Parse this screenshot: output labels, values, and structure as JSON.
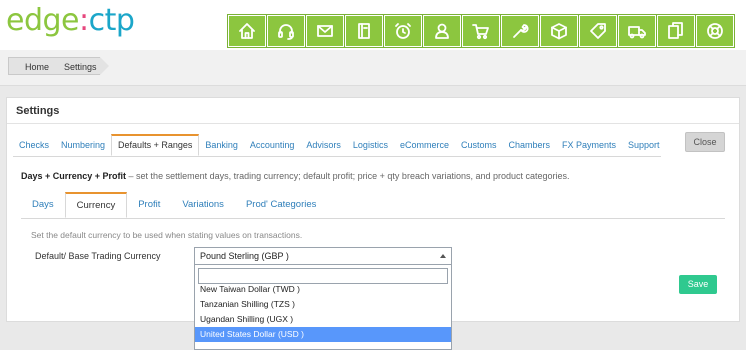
{
  "logo": {
    "part1": "edge",
    "part2": ":",
    "part3": "ctp"
  },
  "toolbar": {
    "icons": [
      "home-icon",
      "headset-icon",
      "mail-icon",
      "notebook-icon",
      "alarm-clock-icon",
      "user-icon",
      "cart-icon",
      "wrench-icon",
      "box-icon",
      "tag-icon",
      "truck-icon",
      "documents-icon",
      "lifebuoy-icon"
    ],
    "accent": "#8cc63f"
  },
  "breadcrumb": {
    "home": "Home",
    "current": "Settings"
  },
  "panel": {
    "title": "Settings",
    "tabs": [
      {
        "label": "Checks"
      },
      {
        "label": "Numbering"
      },
      {
        "label": "Defaults + Ranges"
      },
      {
        "label": "Banking"
      },
      {
        "label": "Accounting"
      },
      {
        "label": "Advisors"
      },
      {
        "label": "Logistics"
      },
      {
        "label": "eCommerce"
      },
      {
        "label": "Customs"
      },
      {
        "label": "Chambers"
      },
      {
        "label": "FX Payments"
      },
      {
        "label": "Support"
      }
    ],
    "active_tab": "Defaults + Ranges",
    "close_label": "Close"
  },
  "section": {
    "title": "Days + Currency + Profit",
    "description": " – set the settlement days, trading currency; default profit; price + qty breach variations, and product categories."
  },
  "subtabs": {
    "items": [
      {
        "label": "Days"
      },
      {
        "label": "Currency"
      },
      {
        "label": "Profit"
      },
      {
        "label": "Variations"
      },
      {
        "label": "Prod' Categories"
      }
    ],
    "active": "Currency"
  },
  "currency": {
    "hint": "Set the default currency to be used when stating values on transactions.",
    "field_label": "Default/ Base Trading Currency",
    "selected": "Pound Sterling (GBP )",
    "search_value": "",
    "options": [
      {
        "label": "New Taiwan Dollar (TWD )",
        "selected": false
      },
      {
        "label": "Tanzanian Shilling (TZS )",
        "selected": false
      },
      {
        "label": "Ugandan Shilling (UGX )",
        "selected": false
      },
      {
        "label": "United States Dollar (USD )",
        "selected": true
      }
    ],
    "save_label": "Save",
    "save_color": "#2fc98f"
  }
}
